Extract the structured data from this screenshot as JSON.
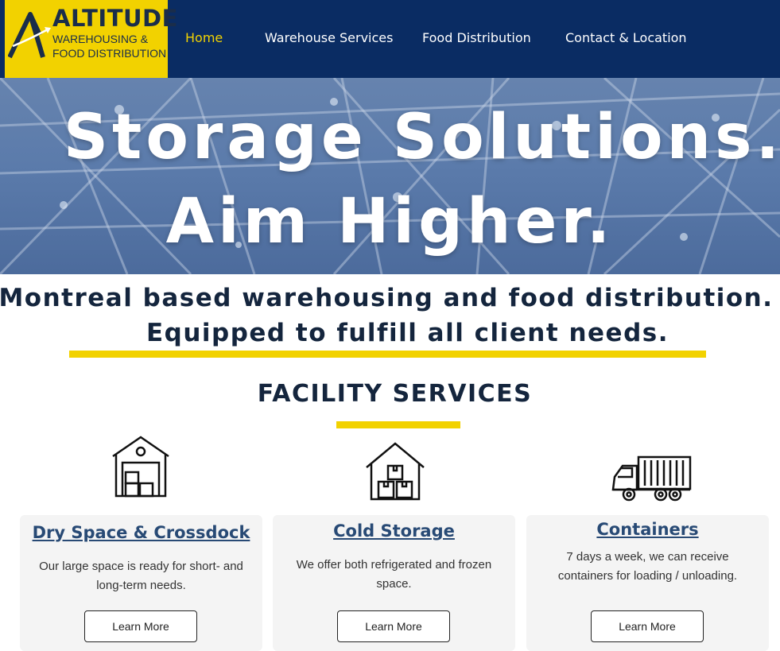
{
  "logo": {
    "title": "ALTITUDE",
    "line1": "WAREHOUSING &",
    "line2": "FOOD DISTRIBUTION",
    "icon": "mountain-arrow-icon"
  },
  "nav": {
    "items": [
      {
        "label": "Home",
        "active": true
      },
      {
        "label": "Warehouse Services",
        "active": false
      },
      {
        "label": "Food Distribution",
        "active": false
      },
      {
        "label": "Contact & Location",
        "active": false
      }
    ]
  },
  "hero": {
    "line1": "Storage Solutions.",
    "line2": "Aim Higher."
  },
  "tagline": {
    "line1": "Montreal based warehousing and food distribution.",
    "line2": "Equipped to fulfill all client needs."
  },
  "section": {
    "title": "FACILITY SERVICES"
  },
  "cards": [
    {
      "icon": "warehouse-icon",
      "title": "Dry Space & Crossdock",
      "desc": "Our large space is ready for short- and long-term needs.",
      "button": "Learn More"
    },
    {
      "icon": "storage-boxes-icon",
      "title": "Cold Storage",
      "desc": "We offer both refrigerated and frozen space.",
      "button": "Learn More"
    },
    {
      "icon": "container-truck-icon",
      "title": "Containers",
      "desc": "7 days a week, we can receive containers for loading / unloading.",
      "button": "Learn More"
    }
  ],
  "colors": {
    "navy": "#0a2c63",
    "yellow": "#f2d200",
    "heading": "#14253d",
    "link": "#284a75"
  }
}
